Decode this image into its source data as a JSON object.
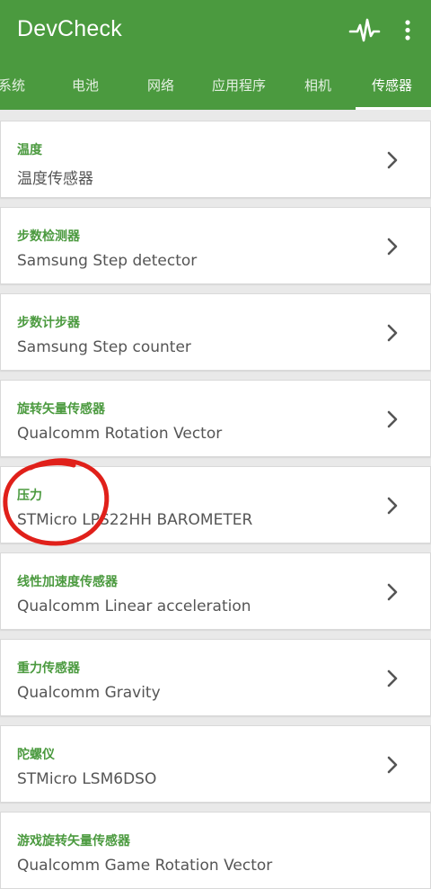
{
  "app": {
    "title": "DevCheck",
    "accent_color": "#4b9a3f",
    "header_icons": [
      "pulse-icon",
      "more-vert-icon"
    ]
  },
  "tabs": [
    {
      "label": "系统",
      "active": false
    },
    {
      "label": "电池",
      "active": false
    },
    {
      "label": "网络",
      "active": false
    },
    {
      "label": "应用程序",
      "active": false
    },
    {
      "label": "相机",
      "active": false
    },
    {
      "label": "传感器",
      "active": true
    }
  ],
  "sensors": [
    {
      "title": "温度",
      "subtitle": "温度传感器"
    },
    {
      "title": "步数检测器",
      "subtitle": "Samsung Step detector"
    },
    {
      "title": "步数计步器",
      "subtitle": "Samsung Step counter"
    },
    {
      "title": "旋转矢量传感器",
      "subtitle": "Qualcomm Rotation Vector"
    },
    {
      "title": "压力",
      "subtitle": "STMicro LPS22HH BAROMETER"
    },
    {
      "title": "线性加速度传感器",
      "subtitle": "Qualcomm Linear acceleration"
    },
    {
      "title": "重力传感器",
      "subtitle": "Qualcomm Gravity"
    },
    {
      "title": "陀螺仪",
      "subtitle": "STMicro LSM6DSO"
    },
    {
      "title": "游戏旋转矢量传感器",
      "subtitle": "Qualcomm Game Rotation Vector"
    }
  ],
  "annotation": {
    "type": "hand-drawn circle",
    "color": "#e0201a",
    "target": "压力"
  }
}
